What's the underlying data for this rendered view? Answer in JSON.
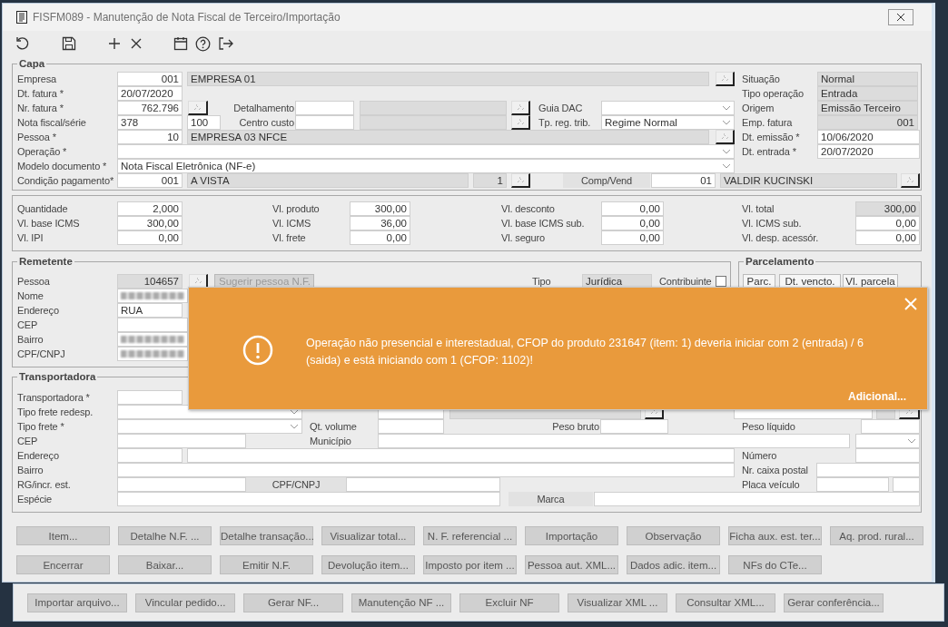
{
  "window": {
    "title": "FISFM089 - Manutenção de Nota Fiscal de Terceiro/Importação"
  },
  "capa": {
    "title": "Capa",
    "items": [
      {
        "kind": "label",
        "text": "Empresa"
      },
      {
        "kind": "input",
        "value": "001"
      },
      {
        "kind": "readonly",
        "value": "EMPRESA 01"
      },
      {
        "kind": "lookup"
      },
      {
        "kind": "label",
        "text": "Situação"
      },
      {
        "kind": "readonly",
        "value": "Normal"
      },
      {
        "kind": "label",
        "text": "Dt. fatura *"
      },
      {
        "kind": "input",
        "value": "20/07/2020"
      },
      {
        "kind": "label",
        "text": "Tipo operação"
      },
      {
        "kind": "readonly",
        "value": "Entrada"
      },
      {
        "kind": "label",
        "text": "Nr. fatura *"
      },
      {
        "kind": "input",
        "value": "762.796"
      },
      {
        "kind": "lookup"
      },
      {
        "kind": "label",
        "text": "Detalhamento"
      },
      {
        "kind": "input"
      },
      {
        "kind": "readonly"
      },
      {
        "kind": "lookup"
      },
      {
        "kind": "label",
        "text": "Guia DAC"
      },
      {
        "kind": "combo"
      },
      {
        "kind": "label",
        "text": "Origem"
      },
      {
        "kind": "readonly",
        "value": "Emissão Terceiro"
      },
      {
        "kind": "label",
        "text": "Nota fiscal/série"
      },
      {
        "kind": "input",
        "value": "378"
      },
      {
        "kind": "input",
        "value": "100"
      },
      {
        "kind": "label",
        "text": "Centro custo"
      },
      {
        "kind": "input"
      },
      {
        "kind": "readonly"
      },
      {
        "kind": "lookup"
      },
      {
        "kind": "label",
        "text": "Tp. reg. trib."
      },
      {
        "kind": "combo",
        "value": "Regime Normal"
      },
      {
        "kind": "label",
        "text": "Emp. fatura"
      },
      {
        "kind": "readonly",
        "value": "001"
      },
      {
        "kind": "label",
        "text": "Pessoa *"
      },
      {
        "kind": "input",
        "value": "10"
      },
      {
        "kind": "readonly",
        "value": "EMPRESA 03 NFCE"
      },
      {
        "kind": "lookup"
      },
      {
        "kind": "label",
        "text": "Dt. emissão *"
      },
      {
        "kind": "input",
        "value": "10/06/2020"
      },
      {
        "kind": "label",
        "text": "Operação *"
      },
      {
        "kind": "combo"
      },
      {
        "kind": "label",
        "text": "Dt. entrada *"
      },
      {
        "kind": "input",
        "value": "20/07/2020"
      },
      {
        "kind": "label",
        "text": "Modelo documento *"
      },
      {
        "kind": "combo",
        "value": "Nota Fiscal Eletrônica (NF-e)"
      },
      {
        "kind": "label",
        "text": "Condição pagamento*"
      },
      {
        "kind": "input",
        "value": "001"
      },
      {
        "kind": "readonly",
        "value": "A VISTA"
      },
      {
        "kind": "readonly",
        "value": "1"
      },
      {
        "kind": "lookup"
      },
      {
        "kind": "label",
        "text": "Comp/Vend"
      },
      {
        "kind": "input",
        "value": "01"
      },
      {
        "kind": "readonly",
        "value": "VALDIR KUCINSKI"
      },
      {
        "kind": "lookup"
      }
    ]
  },
  "totais": {
    "items": [
      {
        "kind": "label",
        "text": "Quantidade"
      },
      {
        "kind": "input",
        "value": "2,000"
      },
      {
        "kind": "label",
        "text": "Vl. produto"
      },
      {
        "kind": "input",
        "value": "300,00"
      },
      {
        "kind": "label",
        "text": "Vl. desconto"
      },
      {
        "kind": "input",
        "value": "0,00"
      },
      {
        "kind": "label",
        "text": "Vl. total"
      },
      {
        "kind": "readonly",
        "value": "300,00"
      },
      {
        "kind": "label",
        "text": "Vl. base ICMS"
      },
      {
        "kind": "input",
        "value": "300,00"
      },
      {
        "kind": "label",
        "text": "Vl. ICMS"
      },
      {
        "kind": "input",
        "value": "36,00"
      },
      {
        "kind": "label",
        "text": "Vl. base ICMS sub."
      },
      {
        "kind": "input",
        "value": "0,00"
      },
      {
        "kind": "label",
        "text": "Vl. ICMS sub."
      },
      {
        "kind": "input",
        "value": "0,00"
      },
      {
        "kind": "label",
        "text": "Vl. IPI"
      },
      {
        "kind": "input",
        "value": "0,00"
      },
      {
        "kind": "label",
        "text": "Vl. frete"
      },
      {
        "kind": "input",
        "value": "0,00"
      },
      {
        "kind": "label",
        "text": "Vl. seguro"
      },
      {
        "kind": "input",
        "value": "0,00"
      },
      {
        "kind": "label",
        "text": "Vl. desp. acessór."
      },
      {
        "kind": "input",
        "value": "0,00"
      }
    ]
  },
  "remetente": {
    "title": "Remetente",
    "items": [
      {
        "kind": "label",
        "text": "Pessoa"
      },
      {
        "kind": "readonly",
        "value": "104657"
      },
      {
        "kind": "lookup"
      },
      {
        "kind": "button",
        "label": "Sugerir pessoa N.F.",
        "disabled": true
      },
      {
        "kind": "label",
        "text": "Tipo"
      },
      {
        "kind": "readonly",
        "value": "Jurídica"
      },
      {
        "kind": "label",
        "text": "Contribuinte"
      },
      {
        "kind": "checkbox",
        "checked": false
      },
      {
        "kind": "label",
        "text": "Nome"
      },
      {
        "kind": "blurred"
      },
      {
        "kind": "label",
        "text": "Endereço"
      },
      {
        "kind": "input",
        "value": "RUA"
      },
      {
        "kind": "label",
        "text": "CEP"
      },
      {
        "kind": "input"
      },
      {
        "kind": "label",
        "text": "Bairro"
      },
      {
        "kind": "blurred"
      },
      {
        "kind": "label",
        "text": "CPF/CNPJ"
      },
      {
        "kind": "blurred"
      }
    ]
  },
  "parcelamento": {
    "title": "Parcelamento",
    "items": [
      {
        "kind": "header",
        "label": "Parc."
      },
      {
        "kind": "header",
        "label": "Dt. vencto."
      },
      {
        "kind": "header",
        "label": "Vl. parcela"
      }
    ]
  },
  "transportadora": {
    "title": "Transportadora",
    "items": [
      {
        "kind": "label",
        "text": "Transportadora *"
      },
      {
        "kind": "input"
      },
      {
        "kind": "label",
        "text": "Tipo frete redesp."
      },
      {
        "kind": "combo"
      },
      {
        "kind": "input"
      },
      {
        "kind": "readonly"
      },
      {
        "kind": "lookup"
      },
      {
        "kind": "input"
      },
      {
        "kind": "readonly"
      },
      {
        "kind": "lookup"
      },
      {
        "kind": "label",
        "text": "Tipo frete *"
      },
      {
        "kind": "combo"
      },
      {
        "kind": "label",
        "text": "Qt. volume"
      },
      {
        "kind": "input"
      },
      {
        "kind": "label",
        "text": "Peso bruto"
      },
      {
        "kind": "input"
      },
      {
        "kind": "label",
        "text": "Peso líquido"
      },
      {
        "kind": "input"
      },
      {
        "kind": "label",
        "text": "CEP"
      },
      {
        "kind": "input"
      },
      {
        "kind": "label",
        "text": "Município"
      },
      {
        "kind": "input"
      },
      {
        "kind": "combo"
      },
      {
        "kind": "label",
        "text": "Endereço"
      },
      {
        "kind": "input"
      },
      {
        "kind": "input"
      },
      {
        "kind": "label",
        "text": "Número"
      },
      {
        "kind": "input"
      },
      {
        "kind": "label",
        "text": "Bairro"
      },
      {
        "kind": "input"
      },
      {
        "kind": "label",
        "text": "Nr. caixa postal"
      },
      {
        "kind": "input"
      },
      {
        "kind": "label",
        "text": "RG/incr. est."
      },
      {
        "kind": "input"
      },
      {
        "kind": "label",
        "text": "CPF/CNPJ"
      },
      {
        "kind": "input"
      },
      {
        "kind": "label",
        "text": "Placa veículo"
      },
      {
        "kind": "input"
      },
      {
        "kind": "input"
      },
      {
        "kind": "label",
        "text": "Espécie"
      },
      {
        "kind": "input"
      },
      {
        "kind": "label",
        "text": "Marca"
      },
      {
        "kind": "input"
      }
    ]
  },
  "action_buttons": [
    {
      "buttons": [
        "Item...",
        "Detalhe N.F. ...",
        "Detalhe transação...",
        "Visualizar total...",
        "N. F. referencial ...",
        "Importação",
        "Observação",
        "Ficha aux. est. ter...",
        "Aq. prod. rural..."
      ]
    },
    {
      "buttons": [
        "Encerrar",
        "Baixar...",
        "Emitir N.F.",
        "Devolução item...",
        "Imposto por item ...",
        "Pessoa aut. XML...",
        "Dados adic. item...",
        "NFs do CTe..."
      ]
    }
  ],
  "background_window": {
    "buttons": [
      "Importar arquivo...",
      "Vincular pedido...",
      "Gerar NF...",
      "Manutenção NF ...",
      "Excluir NF",
      "Visualizar XML ...",
      "Consultar XML...",
      "Gerar conferência..."
    ]
  },
  "alert": {
    "message": "Operação não presencial e interestadual, CFOP do produto 231647 (item: 1) deveria iniciar com 2 (entrada) / 6 (saida) e está iniciando com 1 (CFOP: 1102)!",
    "link": "Adicional..."
  }
}
